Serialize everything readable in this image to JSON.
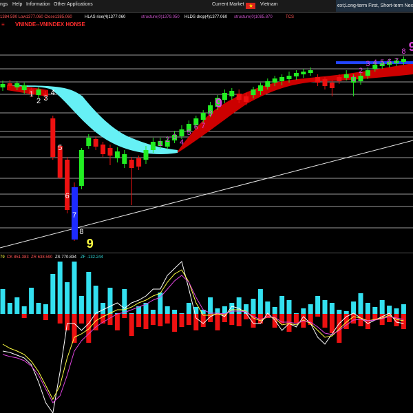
{
  "menu": {
    "items": [
      "ngs",
      "Help",
      "Information",
      "Other Applications",
      "Current Market",
      "Vietnam"
    ],
    "ticker": "ext;Long-term First, Short-term Next"
  },
  "info": {
    "ohlc": "1384.590 Low1377.060 Close1385.060",
    "hlas": "HLAS rise(4)1377.060",
    "structure1": "structure(0)1379.050",
    "hlds": "HLDS drop(4)1377.060",
    "structure2": "structure(0)1085.870",
    "tcs": "TCS"
  },
  "title": {
    "symbol": "VNINDE--VNINDEX HONSE"
  },
  "sub_info": {
    "prefix": "79",
    "ck": "CK 851.383",
    "zr": "ZR 638.590",
    "zs": "ZS 770.834",
    "zf": "ZF -132.244"
  },
  "colors": {
    "up": "#22ee22",
    "down": "#ee1111",
    "cloud_up": "#66f0f5",
    "cloud_down": "#cc0000",
    "menu_bg": "#1a1a1a",
    "magenta": "#dd44dd",
    "yellow": "#ffff44",
    "cyan": "#33dddd",
    "hist_cyan": "#33e0f0",
    "hist_red": "#ee1111"
  },
  "chart_data": [
    {
      "type": "candlestick",
      "title": "",
      "candles": [
        {
          "i": 0,
          "o": 127,
          "c": 122,
          "h": 117,
          "l": 132
        },
        {
          "i": 1,
          "o": 125,
          "c": 121,
          "h": 116,
          "l": 128
        },
        {
          "i": 2,
          "o": 121,
          "c": 127,
          "h": 118,
          "l": 131
        },
        {
          "i": 3,
          "o": 124,
          "c": 131,
          "h": 120,
          "l": 136
        },
        {
          "i": 4,
          "o": 130,
          "c": 137,
          "h": 127,
          "l": 141
        },
        {
          "i": 5,
          "o": 130,
          "c": 138,
          "h": 127,
          "l": 143
        },
        {
          "i": 6,
          "o": 136,
          "c": 140,
          "h": 132,
          "l": 145
        },
        {
          "i": 7,
          "o": 172,
          "c": 228,
          "h": 168,
          "l": 232
        },
        {
          "i": 8,
          "o": 212,
          "c": 258,
          "h": 210,
          "l": 260
        },
        {
          "i": 9,
          "o": 232,
          "c": 305,
          "h": 228,
          "l": 310
        },
        {
          "i": 10,
          "o": 272,
          "c": 345,
          "h": 265,
          "l": 350
        },
        {
          "i": 11,
          "o": 270,
          "c": 218,
          "h": 215,
          "l": 275
        },
        {
          "i": 12,
          "o": 212,
          "c": 200,
          "h": 195,
          "l": 216
        },
        {
          "i": 13,
          "o": 202,
          "c": 213,
          "h": 198,
          "l": 218
        },
        {
          "i": 14,
          "o": 210,
          "c": 224,
          "h": 206,
          "l": 228
        },
        {
          "i": 15,
          "o": 215,
          "c": 226,
          "h": 210,
          "l": 240
        },
        {
          "i": 16,
          "o": 220,
          "c": 230,
          "h": 214,
          "l": 236
        },
        {
          "i": 17,
          "o": 224,
          "c": 238,
          "h": 218,
          "l": 244
        },
        {
          "i": 18,
          "o": 232,
          "c": 244,
          "h": 228,
          "l": 298
        },
        {
          "i": 19,
          "o": 242,
          "c": 230,
          "h": 226,
          "l": 247
        },
        {
          "i": 20,
          "o": 232,
          "c": 218,
          "h": 212,
          "l": 238
        },
        {
          "i": 21,
          "o": 218,
          "c": 206,
          "h": 200,
          "l": 222
        },
        {
          "i": 22,
          "o": 212,
          "c": 205,
          "h": 200,
          "l": 216
        },
        {
          "i": 23,
          "o": 213,
          "c": 204,
          "h": 198,
          "l": 217
        },
        {
          "i": 24,
          "o": 204,
          "c": 196,
          "h": 190,
          "l": 208
        },
        {
          "i": 25,
          "o": 198,
          "c": 188,
          "h": 182,
          "l": 202
        },
        {
          "i": 26,
          "o": 190,
          "c": 180,
          "h": 175,
          "l": 194
        },
        {
          "i": 27,
          "o": 182,
          "c": 172,
          "h": 168,
          "l": 186
        },
        {
          "i": 28,
          "o": 174,
          "c": 164,
          "h": 160,
          "l": 178
        },
        {
          "i": 29,
          "o": 165,
          "c": 153,
          "h": 148,
          "l": 170
        },
        {
          "i": 30,
          "o": 155,
          "c": 142,
          "h": 138,
          "l": 160
        },
        {
          "i": 31,
          "o": 145,
          "c": 135,
          "h": 130,
          "l": 150
        },
        {
          "i": 32,
          "o": 140,
          "c": 132,
          "h": 128,
          "l": 145
        },
        {
          "i": 33,
          "o": 136,
          "c": 145,
          "h": 130,
          "l": 150
        },
        {
          "i": 34,
          "o": 140,
          "c": 148,
          "h": 135,
          "l": 153
        },
        {
          "i": 35,
          "o": 138,
          "c": 130,
          "h": 126,
          "l": 143
        },
        {
          "i": 36,
          "o": 132,
          "c": 124,
          "h": 120,
          "l": 138
        },
        {
          "i": 37,
          "o": 126,
          "c": 118,
          "h": 114,
          "l": 130
        },
        {
          "i": 38,
          "o": 120,
          "c": 114,
          "h": 110,
          "l": 125
        },
        {
          "i": 39,
          "o": 118,
          "c": 112,
          "h": 108,
          "l": 124
        },
        {
          "i": 40,
          "o": 115,
          "c": 110,
          "h": 104,
          "l": 120
        },
        {
          "i": 41,
          "o": 111,
          "c": 106,
          "h": 102,
          "l": 116
        },
        {
          "i": 42,
          "o": 108,
          "c": 104,
          "h": 100,
          "l": 113
        },
        {
          "i": 43,
          "o": 106,
          "c": 102,
          "h": 98,
          "l": 110
        },
        {
          "i": 44,
          "o": 112,
          "c": 120,
          "h": 108,
          "l": 125
        },
        {
          "i": 45,
          "o": 115,
          "c": 125,
          "h": 112,
          "l": 130
        },
        {
          "i": 46,
          "o": 120,
          "c": 128,
          "h": 116,
          "l": 140
        },
        {
          "i": 47,
          "o": 118,
          "c": 112,
          "h": 108,
          "l": 122
        },
        {
          "i": 48,
          "o": 113,
          "c": 108,
          "h": 102,
          "l": 117
        },
        {
          "i": 49,
          "o": 120,
          "c": 112,
          "h": 108,
          "l": 140
        },
        {
          "i": 50,
          "o": 118,
          "c": 110,
          "h": 106,
          "l": 123
        },
        {
          "i": 51,
          "o": 110,
          "c": 102,
          "h": 98,
          "l": 115
        },
        {
          "i": 52,
          "o": 100,
          "c": 94,
          "h": 90,
          "l": 104
        },
        {
          "i": 53,
          "o": 96,
          "c": 92,
          "h": 88,
          "l": 100
        },
        {
          "i": 54,
          "o": 94,
          "c": 90,
          "h": 86,
          "l": 98
        },
        {
          "i": 55,
          "o": 92,
          "c": 88,
          "h": 84,
          "l": 96
        },
        {
          "i": 56,
          "o": 90,
          "c": 86,
          "h": 82,
          "l": 94
        }
      ],
      "candle_colors": [
        "up",
        "down",
        "up",
        "up",
        "down",
        "up",
        "down",
        "down",
        "down",
        "down",
        "down",
        "up",
        "up",
        "down",
        "down",
        "down",
        "up",
        "up",
        "down",
        "down",
        "up",
        "up",
        "up",
        "up",
        "up",
        "up",
        "up",
        "up",
        "up",
        "up",
        "up",
        "up",
        "up",
        "down",
        "down",
        "up",
        "up",
        "up",
        "up",
        "up",
        "up",
        "up",
        "up",
        "up",
        "down",
        "down",
        "down",
        "down",
        "up",
        "up",
        "up",
        "up",
        "up",
        "up",
        "up",
        "up",
        "up"
      ],
      "td_labels": [
        {
          "text": "1",
          "i": 4,
          "v": 140,
          "color": "white"
        },
        {
          "text": "2",
          "i": 5,
          "v": 150,
          "color": "white"
        },
        {
          "text": "3",
          "i": 6,
          "v": 146,
          "color": "white"
        },
        {
          "text": "4",
          "i": 7,
          "v": 138,
          "color": "white"
        },
        {
          "text": "5",
          "i": 8,
          "v": 218,
          "color": "white"
        },
        {
          "text": "6",
          "i": 9,
          "v": 288,
          "color": "white"
        },
        {
          "text": "7",
          "i": 10,
          "v": 316,
          "color": "white"
        },
        {
          "text": "8",
          "i": 11,
          "v": 340,
          "color": "white"
        },
        {
          "text": "9",
          "i": 12,
          "v": 360,
          "color": "yellow"
        },
        {
          "text": "1",
          "i": 22,
          "v": 212,
          "color": "magenta"
        },
        {
          "text": "2",
          "i": 23,
          "v": 206,
          "color": "magenta"
        },
        {
          "text": "3",
          "i": 24,
          "v": 202,
          "color": "magenta"
        },
        {
          "text": "4",
          "i": 25,
          "v": 210,
          "color": "magenta"
        },
        {
          "text": "5",
          "i": 26,
          "v": 196,
          "color": "magenta"
        },
        {
          "text": "6",
          "i": 27,
          "v": 188,
          "color": "magenta"
        },
        {
          "text": "7",
          "i": 28,
          "v": 186,
          "color": "magenta"
        },
        {
          "text": "8",
          "i": 29,
          "v": 168,
          "color": "magenta"
        },
        {
          "text": "9",
          "i": 30,
          "v": 156,
          "color": "magenta"
        },
        {
          "text": "1",
          "i": 49,
          "v": 118,
          "color": "magenta"
        },
        {
          "text": "2",
          "i": 50,
          "v": 106,
          "color": "magenta"
        },
        {
          "text": "3",
          "i": 51,
          "v": 96,
          "color": "magenta"
        },
        {
          "text": "4",
          "i": 52,
          "v": 94,
          "color": "magenta"
        },
        {
          "text": "5",
          "i": 53,
          "v": 94,
          "color": "magenta"
        },
        {
          "text": "6",
          "i": 54,
          "v": 93,
          "color": "magenta"
        },
        {
          "text": "7",
          "i": 55,
          "v": 92,
          "color": "magenta"
        },
        {
          "text": "8",
          "i": 56,
          "v": 78,
          "color": "magenta"
        },
        {
          "text": "9",
          "i": 57,
          "v": 74,
          "color": "magenta"
        }
      ]
    },
    {
      "type": "bar+line",
      "title": "",
      "hist": [
        {
          "cyan": 420,
          "red": 438
        },
        {
          "cyan": 440,
          "red": 444
        },
        {
          "cyan": 432,
          "red": 448
        },
        {
          "cyan": 445,
          "red": 462
        },
        {
          "cyan": 418,
          "red": 456
        },
        {
          "cyan": 440,
          "red": 455
        },
        {
          "cyan": 442,
          "red": 465
        },
        {
          "cyan": 398,
          "red": 450
        },
        {
          "cyan": 380,
          "red": 470
        },
        {
          "cyan": 410,
          "red": 480
        },
        {
          "cyan": 380,
          "red": 498
        },
        {
          "cyan": 430,
          "red": 470
        },
        {
          "cyan": 395,
          "red": 498
        },
        {
          "cyan": 415,
          "red": 480
        },
        {
          "cyan": 440,
          "red": 470
        },
        {
          "cyan": 418,
          "red": 472
        },
        {
          "cyan": 455,
          "red": 480
        },
        {
          "cyan": 420,
          "red": 462
        },
        {
          "cyan": 455,
          "red": 488
        },
        {
          "cyan": 445,
          "red": 475
        },
        {
          "cyan": 440,
          "red": 478
        },
        {
          "cyan": 450,
          "red": 472
        },
        {
          "cyan": 425,
          "red": 474
        },
        {
          "cyan": 445,
          "red": 470
        },
        {
          "cyan": 450,
          "red": 482
        },
        {
          "cyan": 455,
          "red": 475
        },
        {
          "cyan": 440,
          "red": 472
        },
        {
          "cyan": 446,
          "red": 480
        },
        {
          "cyan": 450,
          "red": 475
        },
        {
          "cyan": 432,
          "red": 468
        },
        {
          "cyan": 448,
          "red": 480
        },
        {
          "cyan": 445,
          "red": 468
        },
        {
          "cyan": 440,
          "red": 472
        },
        {
          "cyan": 432,
          "red": 474
        },
        {
          "cyan": 442,
          "red": 464
        },
        {
          "cyan": 434,
          "red": 476
        },
        {
          "cyan": 420,
          "red": 470
        },
        {
          "cyan": 438,
          "red": 462
        },
        {
          "cyan": 446,
          "red": 476
        },
        {
          "cyan": 430,
          "red": 470
        },
        {
          "cyan": 436,
          "red": 482
        },
        {
          "cyan": 455,
          "red": 470
        },
        {
          "cyan": 448,
          "red": 476
        },
        {
          "cyan": 442,
          "red": 472
        },
        {
          "cyan": 430,
          "red": 460
        },
        {
          "cyan": 436,
          "red": 476
        },
        {
          "cyan": 440,
          "red": 484
        },
        {
          "cyan": 450,
          "red": 498
        },
        {
          "cyan": 452,
          "red": 478
        },
        {
          "cyan": 438,
          "red": 470
        },
        {
          "cyan": 426,
          "red": 474
        },
        {
          "cyan": 440,
          "red": 478
        },
        {
          "cyan": 446,
          "red": 465
        },
        {
          "cyan": 436,
          "red": 472
        },
        {
          "cyan": 444,
          "red": 468
        },
        {
          "cyan": 448,
          "red": 474
        },
        {
          "cyan": 442,
          "red": 478
        }
      ],
      "lines": [
        {
          "color": "white",
          "y": [
            510,
            512,
            516,
            520,
            530,
            555,
            585,
            600,
            540,
            470,
            470,
            480,
            470,
            455,
            450,
            445,
            440,
            448,
            440,
            436,
            430,
            420,
            420,
            400,
            390,
            380,
            420,
            462,
            470,
            460,
            455,
            460,
            445,
            448,
            455,
            470,
            470,
            455,
            465,
            480,
            470,
            475,
            460,
            470,
            490,
            500,
            485,
            470,
            460,
            455,
            462,
            470,
            465,
            460,
            455,
            468,
            470
          ]
        },
        {
          "color": "yellow",
          "y": [
            500,
            506,
            510,
            515,
            525,
            540,
            560,
            580,
            560,
            520,
            490,
            485,
            478,
            466,
            460,
            455,
            450,
            450,
            446,
            440,
            436,
            430,
            426,
            410,
            398,
            392,
            410,
            440,
            458,
            458,
            456,
            458,
            450,
            450,
            452,
            462,
            466,
            460,
            462,
            472,
            470,
            472,
            465,
            470,
            480,
            490,
            488,
            478,
            468,
            460,
            462,
            466,
            464,
            462,
            458,
            464,
            466
          ]
        },
        {
          "color": "magenta",
          "y": [
            515,
            518,
            520,
            524,
            532,
            545,
            565,
            585,
            575,
            545,
            510,
            495,
            485,
            475,
            468,
            462,
            456,
            454,
            450,
            446,
            442,
            436,
            432,
            420,
            408,
            400,
            410,
            432,
            450,
            455,
            455,
            456,
            452,
            452,
            453,
            460,
            464,
            460,
            461,
            468,
            468,
            470,
            466,
            468,
            475,
            484,
            486,
            480,
            472,
            465,
            464,
            466,
            465,
            463,
            460,
            462,
            464
          ]
        }
      ]
    }
  ]
}
